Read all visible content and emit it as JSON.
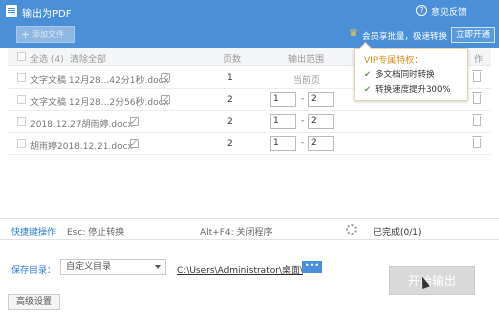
{
  "window": {
    "title": "输出为PDF",
    "feedback_icon": "?",
    "feedback_label": "意见反馈"
  },
  "toolbar": {
    "add_label": "添加文件",
    "add_icon": "+",
    "vip_icon": "crown-icon",
    "vip_text": "会员享批量，极速转换",
    "open_label": "立即开通"
  },
  "table": {
    "headers": {
      "select_all": "全选 (4)",
      "clear_all": "清除全部",
      "pages": "页数",
      "range": "输出范围",
      "action": "作"
    },
    "rows": [
      {
        "name": "文字文稿 12月28...42分1秒.docx",
        "pages": "1",
        "range_text": "当前页"
      },
      {
        "name": "文字文稿 12月28...2分56秒.docx",
        "pages": "2",
        "from": "1",
        "to": "2"
      },
      {
        "name": "2018.12.27胡雨婷.docx",
        "pages": "2",
        "from": "1",
        "to": "2"
      },
      {
        "name": "胡雨婷2018.12.21.docx",
        "pages": "2",
        "from": "1",
        "to": "2"
      }
    ],
    "dash": "-"
  },
  "vip_popup": {
    "title": "VIP专属特权：",
    "check_icon": "✔",
    "items": [
      "多文档同时转换",
      "转换速度提升300%"
    ]
  },
  "shortcut_bar": {
    "title": "快捷键操作",
    "esc": "Esc: 停止转换",
    "altf4": "Alt+F4: 关闭程序",
    "status": "已完成(0/1)"
  },
  "save": {
    "label": "保存目录：",
    "option": "自定义目录",
    "path": "C:\\Users\\Administrator\\桌面\\",
    "browse": "•••"
  },
  "buttons": {
    "start": "开始输出",
    "advanced": "高级设置"
  }
}
